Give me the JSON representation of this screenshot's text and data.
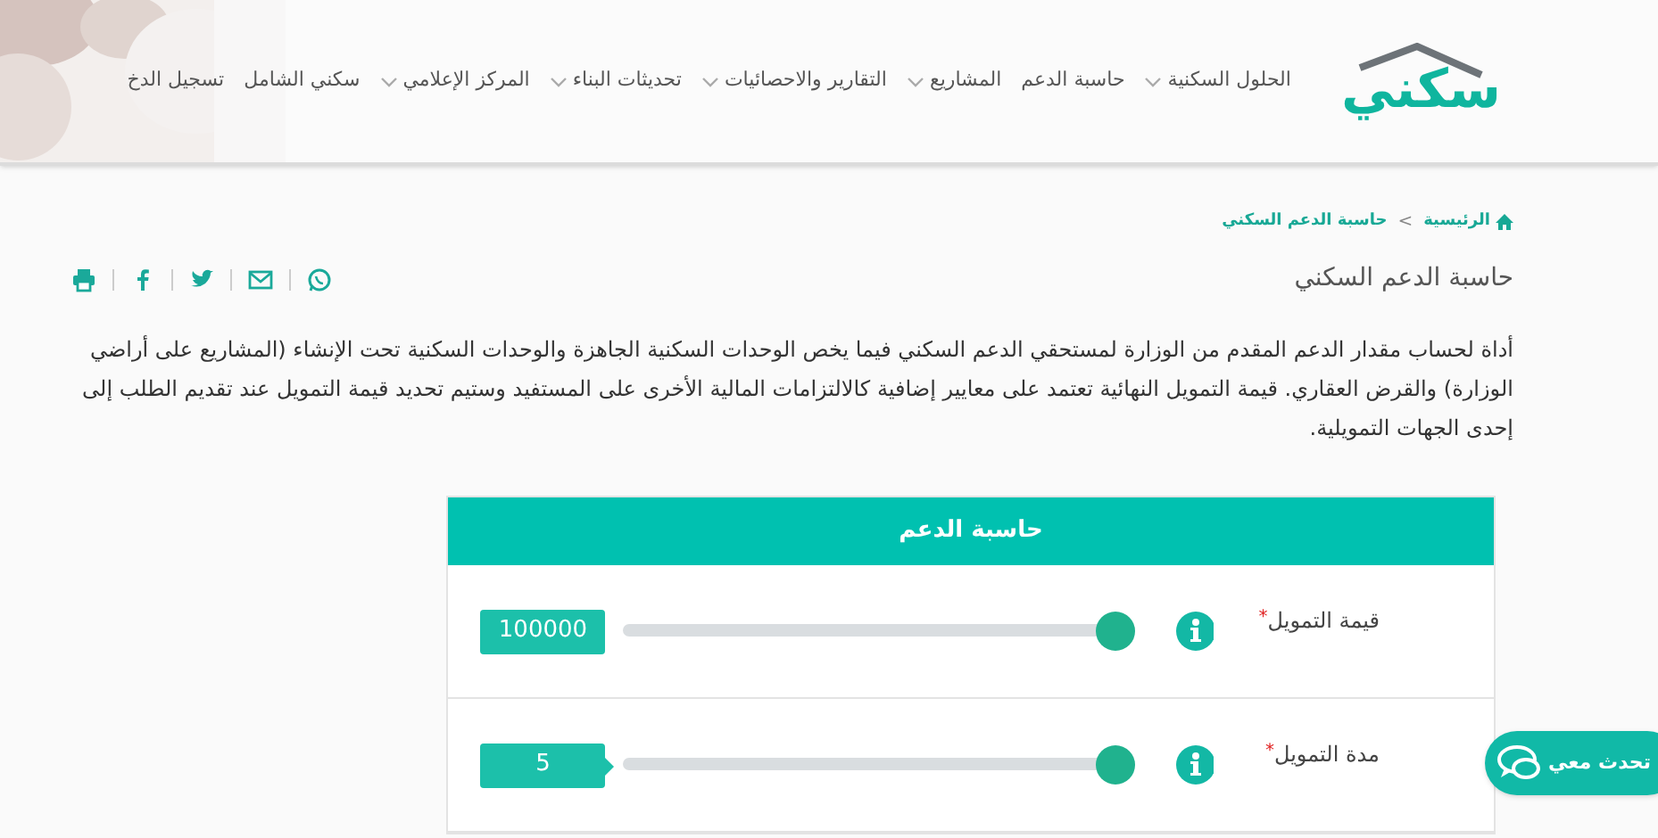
{
  "header": {
    "logo": "سكني",
    "nav": [
      {
        "label": "الحلول السكنية",
        "dropdown": true
      },
      {
        "label": "حاسبة الدعم",
        "dropdown": false
      },
      {
        "label": "المشاريع",
        "dropdown": true
      },
      {
        "label": "التقارير والاحصائيات",
        "dropdown": true
      },
      {
        "label": "تحديثات البناء",
        "dropdown": true
      },
      {
        "label": "المركز الإعلامي",
        "dropdown": true
      },
      {
        "label": "سكني الشامل",
        "dropdown": false
      },
      {
        "label": "تسجيل الدخ",
        "dropdown": false
      }
    ]
  },
  "breadcrumb": {
    "items": [
      {
        "label": "الرئيسية",
        "kind": "home"
      },
      {
        "label": "حاسبة الدعم السكني",
        "kind": "current"
      }
    ],
    "separator": ">"
  },
  "page_title": "حاسبة الدعم السكني",
  "share": [
    {
      "kind": "whatsapp"
    },
    {
      "kind": "email"
    },
    {
      "kind": "twitter"
    },
    {
      "kind": "facebook"
    },
    {
      "kind": "print"
    }
  ],
  "description": "أداة لحساب مقدار الدعم المقدم من الوزارة لمستحقي الدعم السكني فيما يخص الوحدات السكنية الجاهزة والوحدات السكنية تحت الإنشاء (المشاريع على أراضي الوزارة) والقرض العقاري. قيمة التمويل النهائية تعتمد على معايير إضافية كالالتزامات المالية الأخرى على المستفيد وستيم تحديد قيمة التمويل عند تقديم الطلب إلى إحدى الجهات التمويلية.",
  "calculator": {
    "title": "حاسبة الدعم",
    "fields": [
      {
        "label": "قيمة التمويل",
        "required_mark": "*",
        "value": "100000",
        "level": 1,
        "pointer": false
      },
      {
        "label": "مدة التمويل",
        "required_mark": "*",
        "value": "5",
        "level": 1,
        "pointer": true
      }
    ]
  },
  "chat_button": {
    "label": "تحدث معي"
  }
}
